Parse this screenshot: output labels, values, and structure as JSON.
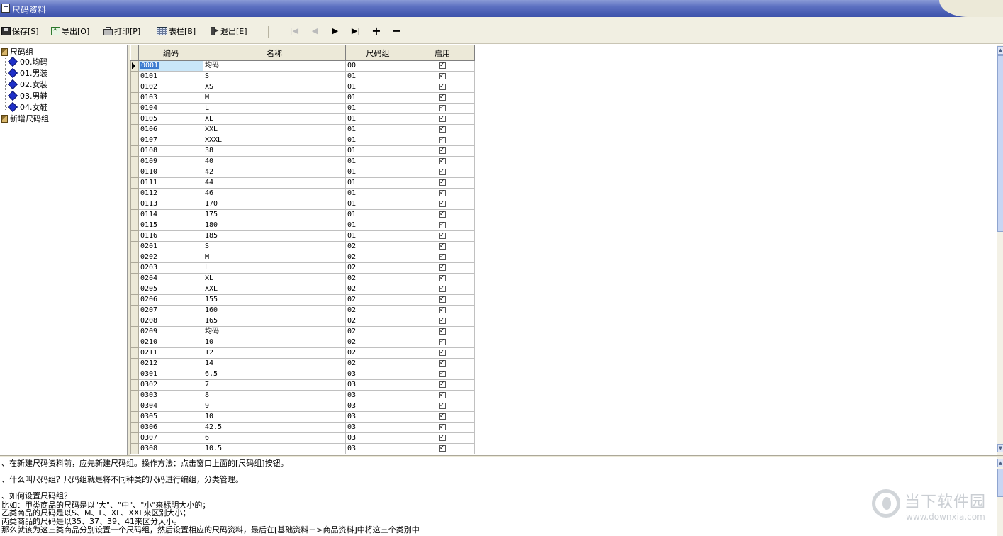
{
  "window": {
    "title": "尺码资料"
  },
  "toolbar": {
    "save": "保存[S]",
    "export": "导出[O]",
    "print": "打印[P]",
    "columns": "表栏[B]",
    "exit": "退出[E]",
    "nav_first": "|◀",
    "nav_prev": "◀",
    "nav_next": "▶",
    "nav_last": "▶|",
    "add": "+",
    "remove": "−"
  },
  "tree": {
    "root": "尺码组",
    "children": [
      "00.均码",
      "01.男装",
      "02.女装",
      "03.男鞋",
      "04.女鞋"
    ],
    "new_group": "新增尺码组"
  },
  "grid": {
    "columns": [
      "编码",
      "名称",
      "尺码组",
      "启用"
    ],
    "rows": [
      {
        "code": "0001",
        "name": "均码",
        "group": "00",
        "enabled": true
      },
      {
        "code": "0101",
        "name": "S",
        "group": "01",
        "enabled": true
      },
      {
        "code": "0102",
        "name": "XS",
        "group": "01",
        "enabled": true
      },
      {
        "code": "0103",
        "name": "M",
        "group": "01",
        "enabled": true
      },
      {
        "code": "0104",
        "name": "L",
        "group": "01",
        "enabled": true
      },
      {
        "code": "0105",
        "name": "XL",
        "group": "01",
        "enabled": true
      },
      {
        "code": "0106",
        "name": "XXL",
        "group": "01",
        "enabled": true
      },
      {
        "code": "0107",
        "name": "XXXL",
        "group": "01",
        "enabled": true
      },
      {
        "code": "0108",
        "name": "38",
        "group": "01",
        "enabled": true
      },
      {
        "code": "0109",
        "name": "40",
        "group": "01",
        "enabled": true
      },
      {
        "code": "0110",
        "name": "42",
        "group": "01",
        "enabled": true
      },
      {
        "code": "0111",
        "name": "44",
        "group": "01",
        "enabled": true
      },
      {
        "code": "0112",
        "name": "46",
        "group": "01",
        "enabled": true
      },
      {
        "code": "0113",
        "name": "170",
        "group": "01",
        "enabled": true
      },
      {
        "code": "0114",
        "name": "175",
        "group": "01",
        "enabled": true
      },
      {
        "code": "0115",
        "name": "180",
        "group": "01",
        "enabled": true
      },
      {
        "code": "0116",
        "name": "185",
        "group": "01",
        "enabled": true
      },
      {
        "code": "0201",
        "name": "S",
        "group": "02",
        "enabled": true
      },
      {
        "code": "0202",
        "name": "M",
        "group": "02",
        "enabled": true
      },
      {
        "code": "0203",
        "name": "L",
        "group": "02",
        "enabled": true
      },
      {
        "code": "0204",
        "name": "XL",
        "group": "02",
        "enabled": true
      },
      {
        "code": "0205",
        "name": "XXL",
        "group": "02",
        "enabled": true
      },
      {
        "code": "0206",
        "name": "155",
        "group": "02",
        "enabled": true
      },
      {
        "code": "0207",
        "name": "160",
        "group": "02",
        "enabled": true
      },
      {
        "code": "0208",
        "name": "165",
        "group": "02",
        "enabled": true
      },
      {
        "code": "0209",
        "name": "均码",
        "group": "02",
        "enabled": true
      },
      {
        "code": "0210",
        "name": "10",
        "group": "02",
        "enabled": true
      },
      {
        "code": "0211",
        "name": "12",
        "group": "02",
        "enabled": true
      },
      {
        "code": "0212",
        "name": "14",
        "group": "02",
        "enabled": true
      },
      {
        "code": "0301",
        "name": "6.5",
        "group": "03",
        "enabled": true
      },
      {
        "code": "0302",
        "name": "7",
        "group": "03",
        "enabled": true
      },
      {
        "code": "0303",
        "name": "8",
        "group": "03",
        "enabled": true
      },
      {
        "code": "0304",
        "name": "9",
        "group": "03",
        "enabled": true
      },
      {
        "code": "0305",
        "name": "10",
        "group": "03",
        "enabled": true
      },
      {
        "code": "0306",
        "name": "42.5",
        "group": "03",
        "enabled": true
      },
      {
        "code": "0307",
        "name": "6",
        "group": "03",
        "enabled": true
      },
      {
        "code": "0308",
        "name": "10.5",
        "group": "03",
        "enabled": true
      }
    ]
  },
  "notes": {
    "line1": "、在新建尺码资料前，应先新建尺码组。操作方法：点击窗口上面的[尺码组]按钮。",
    "line2": "、什么叫尺码组？尺码组就是将不同种类的尺码进行编组，分类管理。",
    "line3": "、如何设置尺码组？",
    "line4": "  比如：甲类商品的尺码是以\"大\"、\"中\"、\"小\"来标明大小的；",
    "line5": "        乙类商品的尺码是以S、M、L、XL、XXL来区别大小；",
    "line6": "        丙类商品的尺码是以35、37、39、41来区分大小。",
    "line7": "        那么就该为这三类商品分别设置一个尺码组，然后设置相应的尺码资料，最后在[基础资料－>商品资料]中将这三个类别中"
  },
  "watermark": {
    "title": "当下软件园",
    "url": "www.downxia.com"
  }
}
